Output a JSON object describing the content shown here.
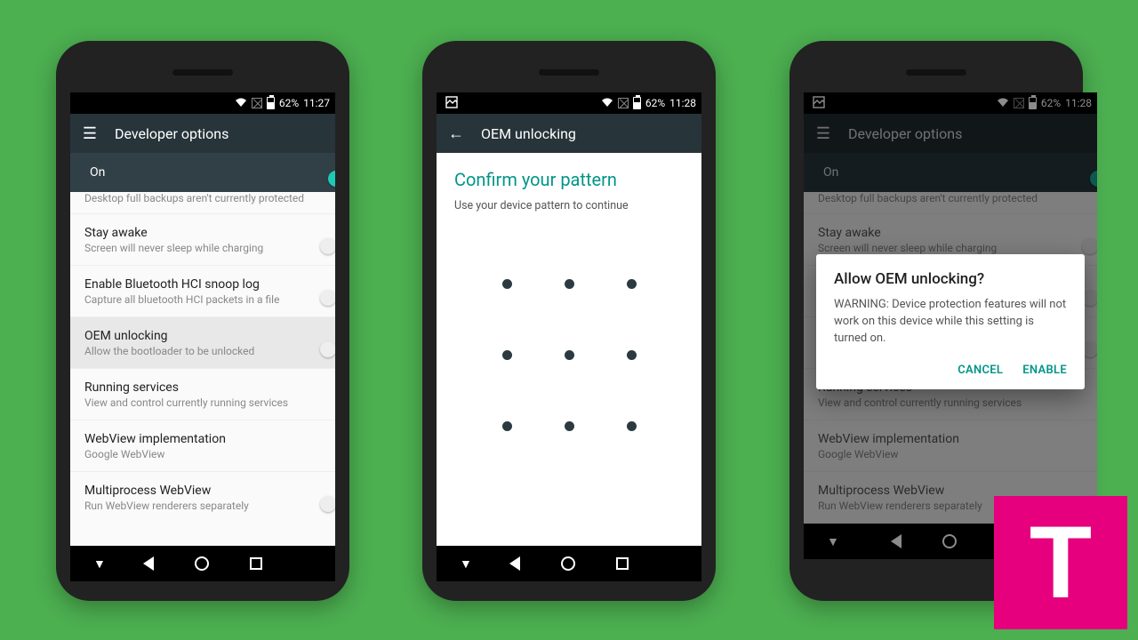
{
  "status": {
    "battery_pct": "62%",
    "time1": "11:27",
    "time2": "11:28",
    "time3": "11:28"
  },
  "phone1": {
    "title": "Developer options",
    "toggle_label": "On",
    "truncated_text": "Desktop full backups aren't currently protected",
    "items": [
      {
        "title": "Stay awake",
        "sub": "Screen will never sleep while charging",
        "switch": true
      },
      {
        "title": "Enable Bluetooth HCI snoop log",
        "sub": "Capture all bluetooth HCI packets in a file",
        "switch": true
      },
      {
        "title": "OEM unlocking",
        "sub": "Allow the bootloader to be unlocked",
        "switch": true,
        "highlight": true
      },
      {
        "title": "Running services",
        "sub": "View and control currently running services"
      },
      {
        "title": "WebView implementation",
        "sub": "Google WebView"
      },
      {
        "title": "Multiprocess WebView",
        "sub": "Run WebView renderers separately",
        "switch": true
      }
    ]
  },
  "phone2": {
    "title": "OEM unlocking",
    "heading": "Confirm your pattern",
    "body": "Use your device pattern to continue"
  },
  "phone3": {
    "title": "Developer options",
    "toggle_label": "On",
    "dialog": {
      "title": "Allow OEM unlocking?",
      "body": "WARNING: Device protection features will not work on this device while this setting is turned on.",
      "cancel": "CANCEL",
      "ok": "ENABLE"
    }
  },
  "logo_letter": "T"
}
